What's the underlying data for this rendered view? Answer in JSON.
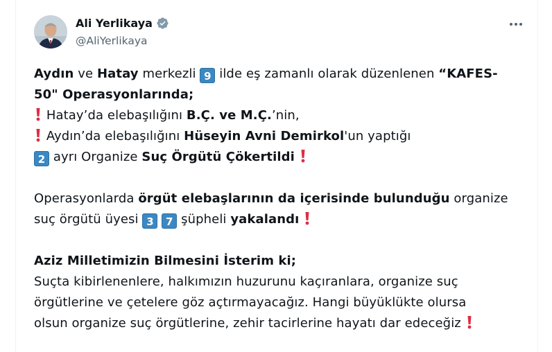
{
  "author": {
    "name": "Ali Yerlikaya",
    "handle": "@AliYerlikaya",
    "verified_icon": "verified-badge-icon",
    "avatar_icon": "profile-avatar"
  },
  "more_icon": "more-options-icon",
  "tweet": {
    "p1_l1_a": "Aydın",
    "p1_l1_b": " ve ",
    "p1_l1_c": "Hatay",
    "p1_l1_d": " merkezli ",
    "p1_l1_key": "9",
    "p1_l1_e": " ilde eş zamanlı olarak düzenlenen ",
    "p1_l1_f": "“KAFES-",
    "p1_l2": "50\" Operasyonlarında;",
    "p1_l3_a": " Hatay’da elebaşılığını ",
    "p1_l3_b": "B.Ç. ve M.Ç.",
    "p1_l3_c": "’nin,",
    "p1_l4_a": " Aydın’da elebaşılığını ",
    "p1_l4_b": "Hüseyin Avni Demirkol",
    "p1_l4_c": "'un yaptığı",
    "p1_l5_key": "2",
    "p1_l5_a": " ayrı Organize ",
    "p1_l5_b": "Suç Örgütü Çökertildi",
    "p2_l1_a": "Operasyonlarda ",
    "p2_l1_b": "örgüt elebaşlarının da içerisinde bulunduğu",
    "p2_l1_c": " organize",
    "p2_l2_a": "suç örgütü üyesi ",
    "p2_l2_key1": "3",
    "p2_l2_key2": "7",
    "p2_l2_b": " şüpheli ",
    "p2_l2_c": "yakalandı",
    "p3_l1": "Aziz Milletimizin Bilmesini İsterim ki;",
    "p3_l2": "Suçta kibirlenenlere, halkımızın huzurunu kaçıranlara, organize suç",
    "p3_l3": "örgütlerine ve çetelere göz açtırmayacağız. Hangi büyüklükte olursa",
    "p3_l4": "olsun organize suç örgütlerine, zehir tacirlerine hayatı dar edeceğiz"
  },
  "emoji": {
    "exclamation": "red-exclamation-icon",
    "keycap_color": "#3b88c3",
    "exclamation_color": "#dd2e44"
  }
}
